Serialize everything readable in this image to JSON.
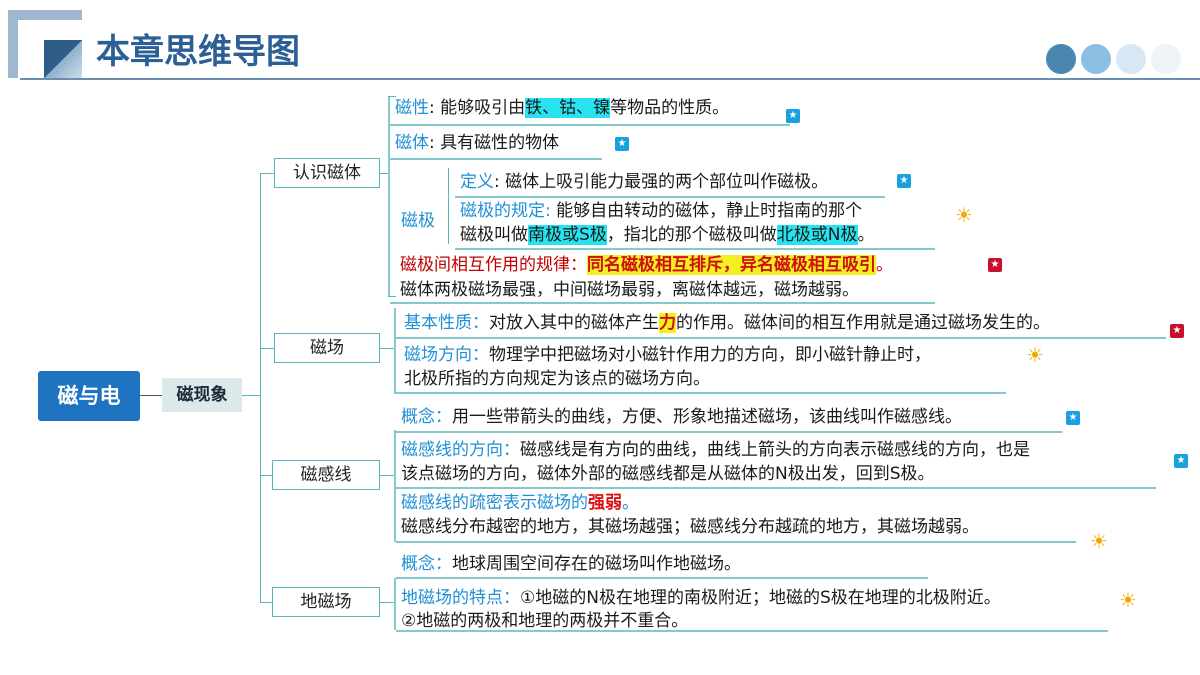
{
  "header": {
    "title": "本章思维导图"
  },
  "root": {
    "label": "磁与电"
  },
  "level1": {
    "label": "磁现象"
  },
  "branches": {
    "renshi": {
      "label": "认识磁体",
      "cixing": {
        "key": "磁性",
        "sep": ": 能够吸引由",
        "hl": "铁、钴、镍",
        "rest": "等物品的性质。"
      },
      "citi": {
        "key": "磁体",
        "rest": ": 具有磁性的物体"
      },
      "ciji": {
        "label": "磁极",
        "dingyi": {
          "key": "定义",
          "rest": ": 磁体上吸引能力最强的两个部位叫作磁极。"
        },
        "guiding": {
          "key": "磁极的规定:",
          "line1": " 能够自由转动的磁体，静止时指南的那个",
          "l2a": "磁极叫做",
          "l2hl1": "南极或S极",
          "l2b": "，指北的那个磁极叫做",
          "l2hl2": "北极或N极",
          "l2c": "。"
        }
      },
      "guilv": {
        "key": "磁极间相互作用的规律：",
        "hl": "同名磁极相互排斥，异名磁极相互吸引",
        "end": "。"
      },
      "qiangruo": "磁体两极磁场最强，中间磁场最弱，离磁体越远，磁场越弱。"
    },
    "cichang": {
      "label": "磁场",
      "xingzhi": {
        "key": "基本性质：",
        "a": "对放入其中的磁体产生",
        "hl": "力",
        "b": "的作用。磁体间的相互作用就是通过磁场发生的。"
      },
      "fangxiang": {
        "key": "磁场方向：",
        "line1": "物理学中把磁场对小磁针作用力的方向，即小磁针静止时，",
        "line2": "北极所指的方向规定为该点的磁场方向。"
      }
    },
    "cigan": {
      "label": "磁感线",
      "gainian": {
        "key": "概念：",
        "rest": "用一些带箭头的曲线，方便、形象地描述磁场，该曲线叫作磁感线。"
      },
      "fangxiang": {
        "key": "磁感线的方向：",
        "line1": "磁感线是有方向的曲线，曲线上箭头的方向表示磁感线的方向，也是",
        "line2": "该点磁场的方向，磁体外部的磁感线都是从磁体的N极出发，回到S极。"
      },
      "shumi": {
        "key": "磁感线的疏密表示磁场的",
        "red": "强弱",
        "end": "。",
        "line2": "磁感线分布越密的地方，其磁场越强；磁感线分布越疏的地方，其磁场越弱。"
      }
    },
    "dici": {
      "label": "地磁场",
      "gainian": {
        "key": "概念：",
        "rest": "地球周围空间存在的磁场叫作地磁场。"
      },
      "tedian": {
        "key": "地磁场的特点：",
        "line1": "①地磁的N极在地理的南极附近；地磁的S极在地理的北极附近。",
        "line2": "②地磁的两极和地理的两极并不重合。"
      }
    }
  },
  "colors": {
    "accent": "#1f8fd6",
    "header_blue": "#2b6fb6",
    "line": "#5ab6b9",
    "highlight_cyan": "#27e3f0",
    "highlight_yellow": "#f5ef1f"
  },
  "icons": {
    "star": "star-icon",
    "sun": "sun-icon"
  }
}
